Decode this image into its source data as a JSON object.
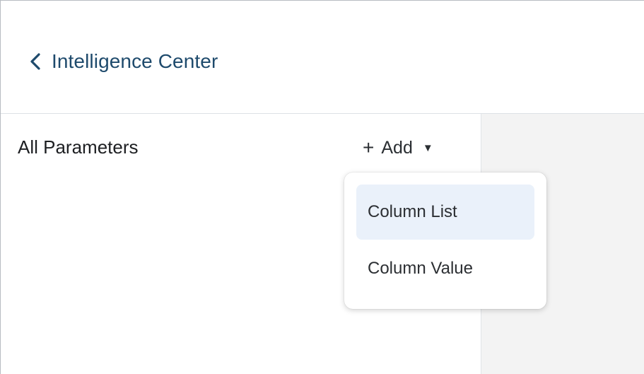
{
  "header": {
    "back_label": "Intelligence Center",
    "back_icon": "chevron-left-icon"
  },
  "panel": {
    "title": "All Parameters",
    "add_button": {
      "plus_glyph": "+",
      "label": "Add",
      "caret_glyph": "▼"
    }
  },
  "dropdown": {
    "items": [
      {
        "label": "Column List",
        "highlighted": true
      },
      {
        "label": "Column Value",
        "highlighted": false
      }
    ]
  },
  "colors": {
    "accent_text": "#1e4a6c",
    "highlight_bg": "#eaf1fa",
    "right_panel_bg": "#f3f3f3"
  }
}
